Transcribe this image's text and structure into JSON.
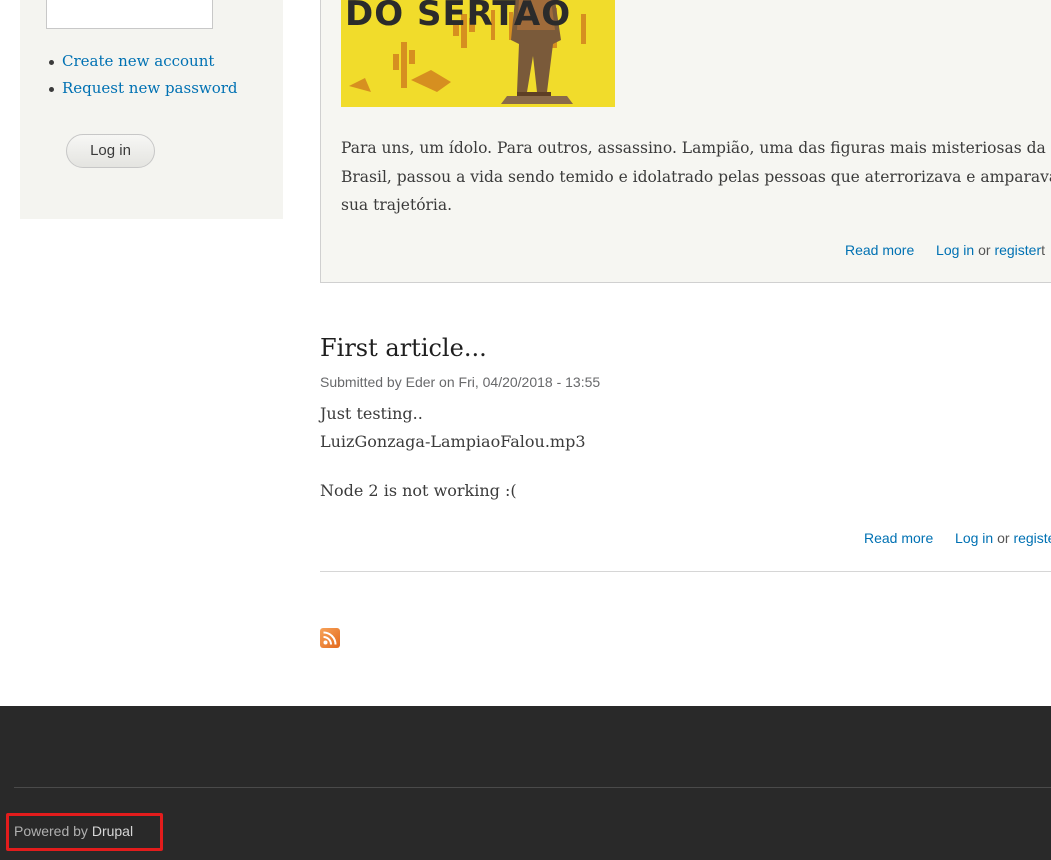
{
  "sidebar": {
    "links": [
      {
        "label": "Create new account"
      },
      {
        "label": "Request new password"
      }
    ],
    "login_button": "Log in"
  },
  "teaser": {
    "image": {
      "visible_text": "DO SERTÃO",
      "colors": {
        "background": "#f1dc2b",
        "drawing": "#d4871f"
      }
    },
    "body_lines": [
      "Para uns, um ídolo. Para outros, assassino. Lampião, uma das figuras mais misteriosas da hi",
      "Brasil, passou a vida sendo temido e idolatrado pelas pessoas que aterrorizava e amparava. C",
      "sua trajetória."
    ],
    "links": {
      "read_more": "Read more",
      "log_in": "Log in",
      "or": "or",
      "register": "register",
      "suffix": "t"
    }
  },
  "article": {
    "title": "First article...",
    "meta": "Submitted by Eder on Fri, 04/20/2018 - 13:55",
    "body_lines": [
      "Just testing..",
      "LuizGonzaga-LampiaoFalou.mp3"
    ],
    "note": "Node 2 is not working :(",
    "links": {
      "read_more": "Read more",
      "log_in": "Log in",
      "or": "or",
      "register": "registe"
    }
  },
  "feed": {
    "icon": "rss-icon"
  },
  "footer": {
    "powered_by": "Powered by",
    "drupal": "Drupal",
    "highlight_color": "#e21c1c"
  },
  "colors": {
    "link": "#0071b3",
    "sidebar_bg": "#f4f4f0",
    "footer_bg": "#292929"
  }
}
